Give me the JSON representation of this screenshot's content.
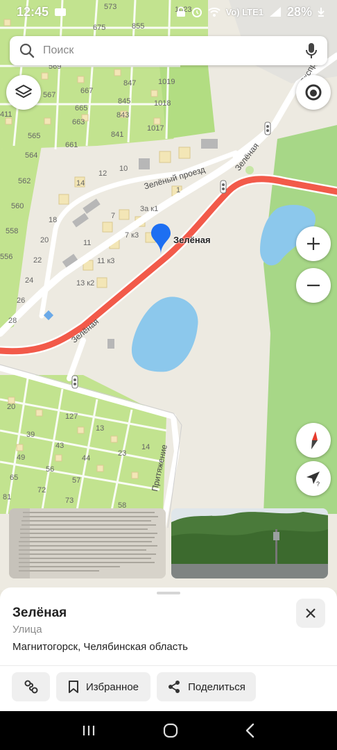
{
  "status_bar": {
    "time": "12:45",
    "network": "Vo) LTE1",
    "battery": "28%"
  },
  "search": {
    "placeholder": "Поиск"
  },
  "map": {
    "labels": {
      "n573": "573",
      "n675": "675",
      "n855": "855",
      "n1023": "1023",
      "n569": "569",
      "n567": "567",
      "n565": "565",
      "n564": "564",
      "n562": "562",
      "n560": "560",
      "n558": "558",
      "n556": "556",
      "n411": "411",
      "n667": "667",
      "n665": "665",
      "n663": "663",
      "n661": "661",
      "n847": "847",
      "n845": "845",
      "n843": "843",
      "n841": "841",
      "n1019": "1019",
      "n1018": "1018",
      "n1017": "1017",
      "n14": "14",
      "n12": "12",
      "n10": "10",
      "n1": "1",
      "n18": "18",
      "n20": "20",
      "n22": "22",
      "n24": "24",
      "n26": "26",
      "n28": "28",
      "n7": "7",
      "n3ak1": "3а к1",
      "n7k3": "7 к3",
      "n11": "11",
      "n11k3": "11 к3",
      "n13k2": "13 к2",
      "g20": "20",
      "g39": "39",
      "g49": "49",
      "g65": "65",
      "g81": "81",
      "g127": "127",
      "g13": "13",
      "g43": "43",
      "g44": "44",
      "g56": "56",
      "g57": "57",
      "g72": "72",
      "g73": "73",
      "g23": "23",
      "g14": "14",
      "g58": "58"
    },
    "road_labels": {
      "zelenyi_proezd": "Зелёный проезд",
      "zelenaya_top": "Зелёная",
      "zelenaya_bottom": "Зелёная",
      "prityazhenie": "Притяжение",
      "ekspress": "Экспресс"
    },
    "pin_label": "Зелёная"
  },
  "bottom_card": {
    "title": "Зелёная",
    "type": "Улица",
    "address": "Магнитогорск, Челябинская область",
    "actions": {
      "favorites": "Избранное",
      "share": "Поделиться"
    }
  },
  "colors": {
    "accent_route": "#f25a4a",
    "pin": "#1d6ff2",
    "water": "#8cc8ec",
    "green_plot": "#bfe08e",
    "forest": "#a8d88a"
  }
}
